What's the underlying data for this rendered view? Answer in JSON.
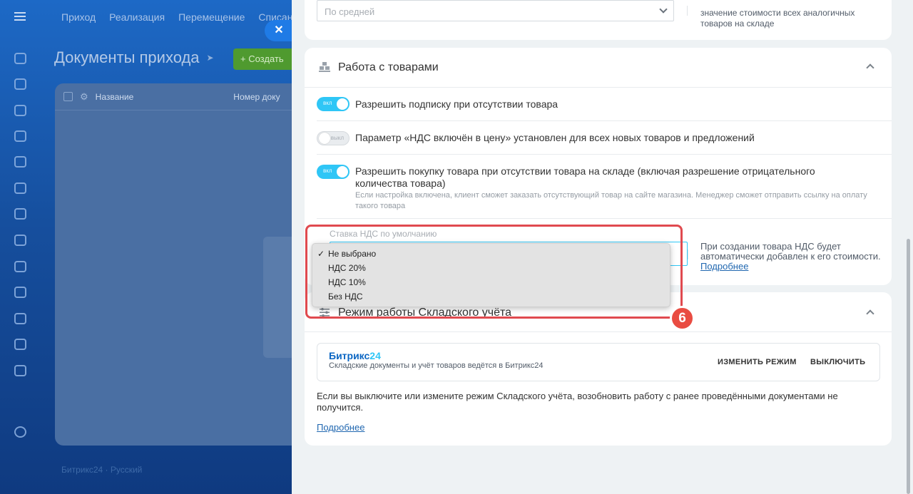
{
  "background": {
    "nav_items": [
      "Приход",
      "Реализация",
      "Перемещение",
      "Списан"
    ],
    "page_title": "Документы прихода",
    "create_label": "+ Создать",
    "table_columns": [
      "Название",
      "Номер доку"
    ],
    "footer": "Битрикс24 · Русский"
  },
  "panel": {
    "prev_card": {
      "select_value": "По средней",
      "hint": "значение стоимости всех аналогичных товаров на складе"
    },
    "goods": {
      "title": "Работа с товарами",
      "options": [
        {
          "label": "Разрешить подписку при отсутствии товара",
          "state": "вкл",
          "on": true
        },
        {
          "label": "Параметр «НДС включён в цену» установлен для всех новых товаров и предложений",
          "state": "выкл",
          "on": false
        },
        {
          "label": "Разрешить покупку товара при отсутствии товара на складе (включая разрешение отрицательного количества товара)",
          "state": "вкл",
          "on": true,
          "description": "Если настройка включена, клиент сможет заказать отсутствующий товар на сайте магазина. Менеджер сможет отправить ссылку на оплату такого товара"
        }
      ],
      "vat": {
        "label": "Ставка НДС по умолчанию",
        "hint": "При создании товара НДС будет автоматически добавлен к его стоимости.",
        "hint_link": "Подробнее"
      }
    },
    "mode": {
      "title": "Режим работы Складского учёта",
      "brand_name": "Битрикс",
      "brand_num": "24",
      "brand_desc": "Складские документы и учёт товаров ведётся в Битрикс24",
      "change_label": "ИЗМЕНИТЬ РЕЖИМ",
      "disable_label": "ВЫКЛЮЧИТЬ",
      "warning": "Если вы выключите или измените режим Складского учёта, возобновить работу с ранее проведёнными документами не получится.",
      "link": "Подробнее"
    }
  },
  "dropdown": {
    "selected": "Не выбрано",
    "options": [
      "Не выбрано",
      "НДС 20%",
      "НДС 10%",
      "Без НДС"
    ]
  },
  "annotation": {
    "badge": "6",
    "color": "#e94c42"
  },
  "colors": {
    "accent": "#2fc6f6",
    "link": "#2067b0",
    "panel_bg": "#eef2f4"
  }
}
